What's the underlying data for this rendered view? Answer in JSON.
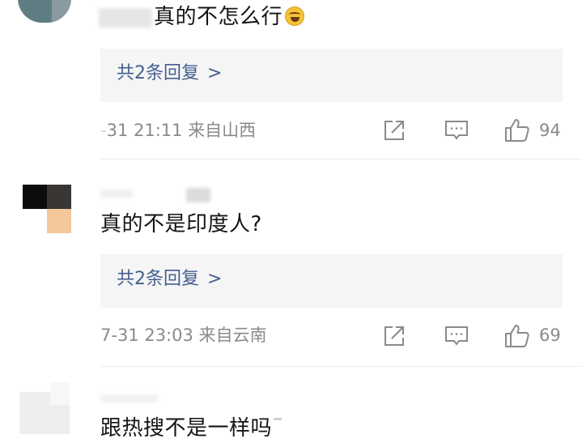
{
  "comments": [
    {
      "text": "真的不怎么行",
      "reply_count_label": "共2条回复",
      "time_prefix": "-",
      "time": "31 21:11",
      "location": "来自山西",
      "likes": "94"
    },
    {
      "text": "真的不是印度人?",
      "reply_count_label": "共2条回复",
      "time": "7-31 23:03",
      "location": "来自云南",
      "likes": "69"
    },
    {
      "text": "跟热搜不是一样吗"
    }
  ],
  "icons": {
    "share": "share-icon",
    "comment": "comment-icon",
    "like": "thumbs-up-icon",
    "emoji": "laughing-crying-emoji-icon",
    "chevron": "chevron-right-icon"
  },
  "colors": {
    "link": "#445f8f",
    "meta": "#8a8a8a",
    "reply_bg": "#f5f5f5",
    "text": "#151515"
  }
}
